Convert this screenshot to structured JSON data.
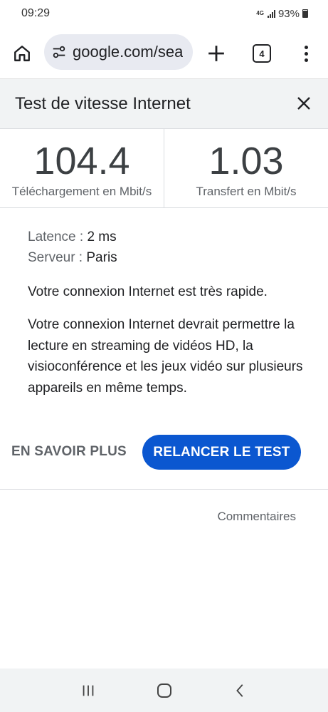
{
  "status": {
    "time": "09:29",
    "network": "4G",
    "battery": "93%"
  },
  "browser": {
    "url": "google.com/sea",
    "tab_count": "4",
    "icons": [
      "home-icon",
      "site-settings-icon",
      "new-tab-icon",
      "tab-switcher-icon",
      "more-menu-icon"
    ]
  },
  "speedtest": {
    "title": "Test de vitesse Internet",
    "download": {
      "value": "104.4",
      "unit": "Téléchargement en Mbit/s"
    },
    "upload": {
      "value": "1.03",
      "unit": "Transfert en Mbit/s"
    },
    "latency_label": "Latence :",
    "latency_value": "2 ms",
    "server_label": "Serveur :",
    "server_value": "Paris",
    "speed_message": "Votre connexion Internet est très rapide.",
    "speed_description": "Votre connexion Internet devrait permettre la lecture en streaming de vidéos HD, la visioconférence et les jeux vidéo sur plusieurs appareils en même temps.",
    "learn_more": "EN SAVOIR PLUS",
    "rerun": "RELANCER LE TEST",
    "feedback": "Commentaires"
  },
  "colors": {
    "primary_button": "#0b57d0",
    "header_bg": "#f1f3f4",
    "url_bar_bg": "#e8eaf1"
  }
}
